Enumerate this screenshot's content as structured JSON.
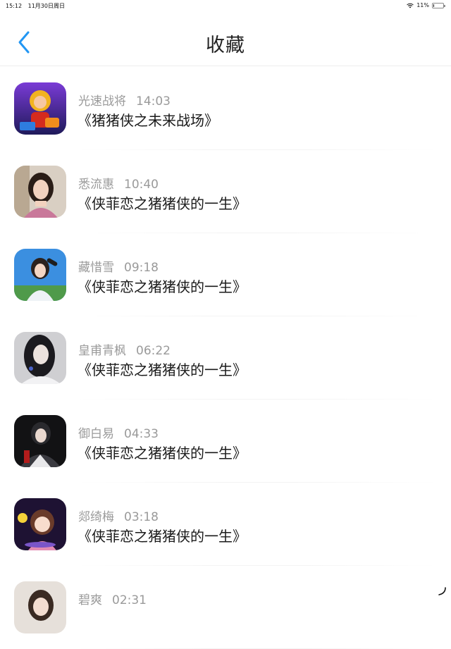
{
  "status_bar": {
    "time": "15:12",
    "date": "11月30日周日",
    "battery_text": "11%",
    "battery_level": 0.11
  },
  "header": {
    "title": "收藏",
    "back_icon": "chevron-left-icon",
    "accent_color": "#2196f3"
  },
  "favorites": [
    {
      "name": "光速战将",
      "time": "14:03",
      "message": "《猪猪侠之未来战场》",
      "avatar": "cartoon-hero"
    },
    {
      "name": "悉流惠",
      "time": "10:40",
      "message": "《侠菲恋之猪猪侠的一生》",
      "avatar": "woman-portrait"
    },
    {
      "name": "藏惜雪",
      "time": "09:18",
      "message": "《侠菲恋之猪猪侠的一生》",
      "avatar": "girl-sky"
    },
    {
      "name": "皇甫青枫",
      "time": "06:22",
      "message": "《侠菲恋之猪猪侠的一生》",
      "avatar": "woman-dark"
    },
    {
      "name": "御白易",
      "time": "04:33",
      "message": "《侠菲恋之猪猪侠的一生》",
      "avatar": "game-character"
    },
    {
      "name": "郯绮梅",
      "time": "03:18",
      "message": "《侠菲恋之猪猪侠的一生》",
      "avatar": "anime-girl"
    },
    {
      "name": "碧爽",
      "time": "02:31",
      "message": "",
      "avatar": "woman-light"
    }
  ]
}
